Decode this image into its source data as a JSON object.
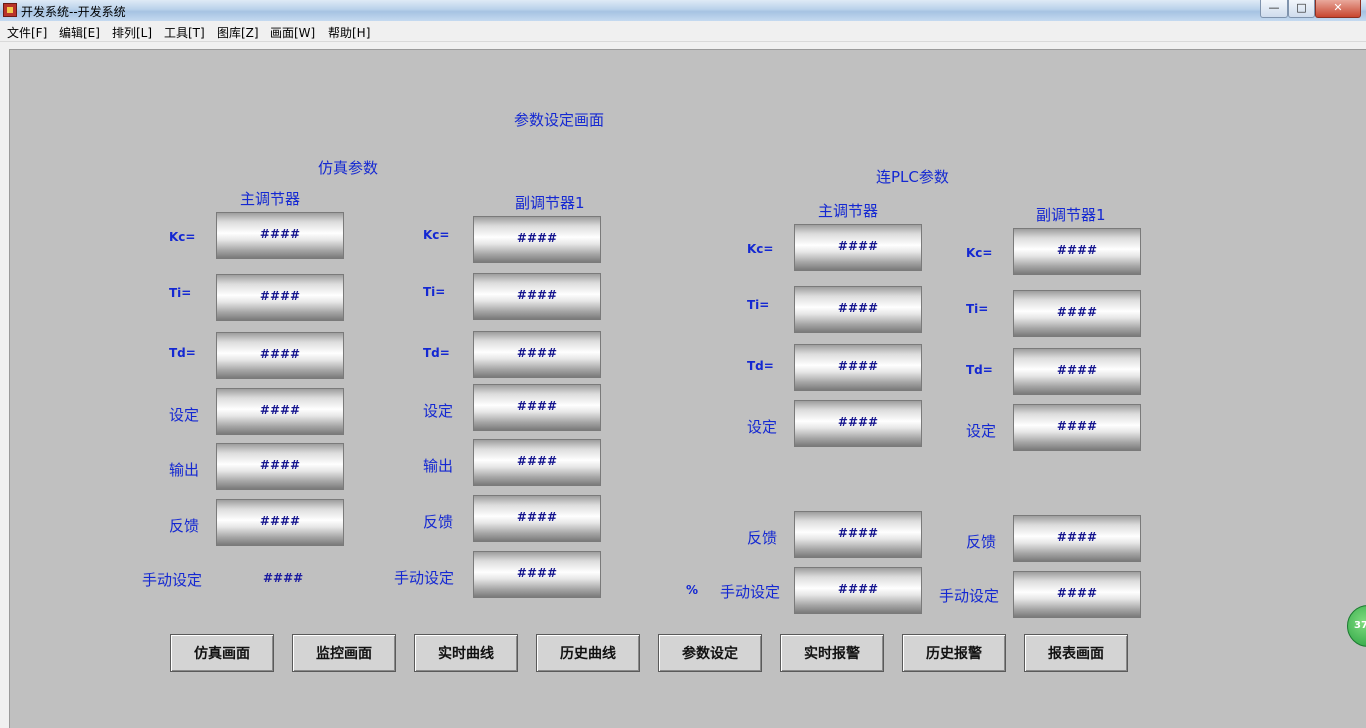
{
  "window": {
    "title": "开发系统--开发系统"
  },
  "menu": [
    "文件[F]",
    "编辑[E]",
    "排列[L]",
    "工具[T]",
    "图库[Z]",
    "画面[W]",
    "帮助[H]"
  ],
  "window_buttons": {
    "minimize": "—",
    "maximize": "□",
    "close": "✕"
  },
  "screen": {
    "title": "参数设定画面",
    "sim_section": "仿真参数",
    "plc_section": "连PLC参数",
    "groups": {
      "sim_main": "主调节器",
      "sim_sub": "副调节器1",
      "plc_main": "主调节器",
      "plc_sub": "副调节器1"
    },
    "labels": {
      "kc": "Kc=",
      "ti": "Ti=",
      "td": "Td=",
      "setpoint": "设定",
      "output": "输出",
      "feedback": "反馈",
      "manual": "手动设定",
      "percent": "%"
    },
    "placeholder": "####"
  },
  "nav_buttons": [
    "仿真画面",
    "监控画面",
    "实时曲线",
    "历史曲线",
    "参数设定",
    "实时报警",
    "历史报警",
    "报表画面"
  ],
  "floating_badge": "37"
}
